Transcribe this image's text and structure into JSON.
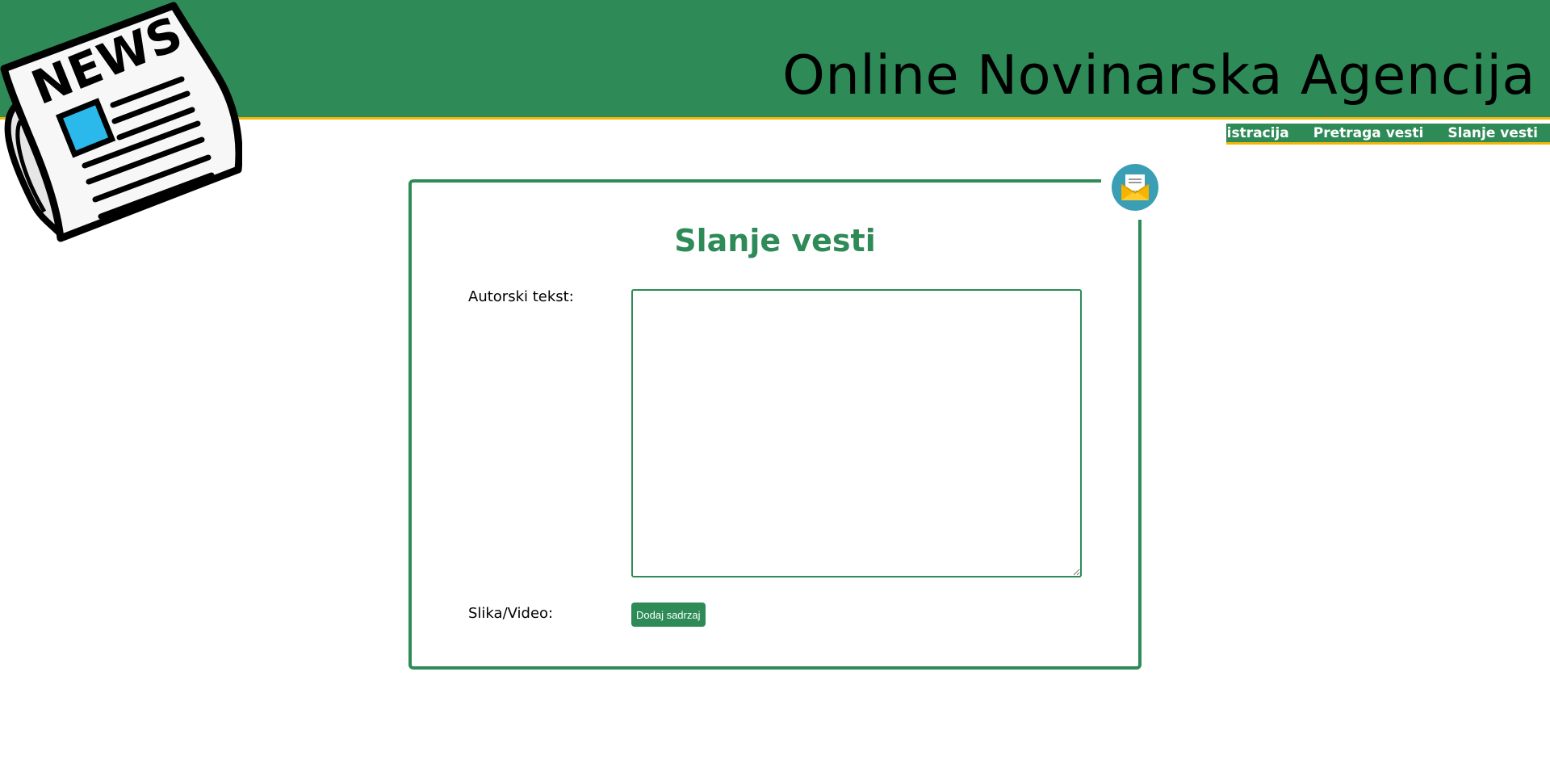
{
  "header": {
    "title": "Online Novinarska Agencija",
    "logo_text": "NEWS",
    "logo_icon": "newspaper-icon"
  },
  "nav": {
    "items": [
      {
        "label": "Registracija"
      },
      {
        "label": "Pretraga vesti"
      },
      {
        "label": "Slanje vesti"
      }
    ]
  },
  "form": {
    "title": "Slanje vesti",
    "badge_icon": "envelope-icon",
    "text_label": "Autorski tekst:",
    "text_value": "",
    "media_label": "Slika/Video:",
    "add_button_label": "Dodaj sadrzaj"
  },
  "colors": {
    "primary": "#2e8b57",
    "accent_border": "#f2b705",
    "badge": "#3a9fb5"
  }
}
